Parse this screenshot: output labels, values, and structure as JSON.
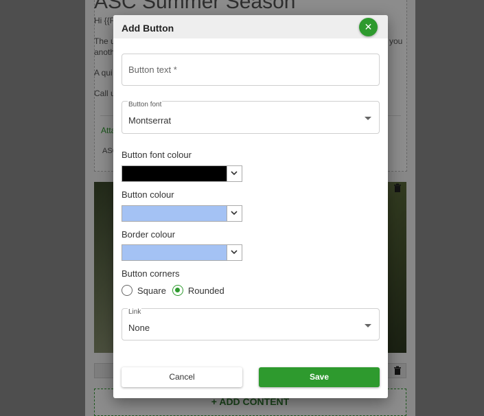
{
  "background": {
    "title": "ASC Summer Season",
    "greeting": "Hi {{F",
    "line1": "The u",
    "line1_right": "you",
    "line1b": "anoth",
    "line2": "A qui",
    "line3": "Call u",
    "attach_link": "Atta",
    "attach_item": "ASC",
    "add_content_label": "+ ADD CONTENT",
    "trash_icon": "trash-icon"
  },
  "dialog": {
    "title": "Add Button",
    "close_icon": "close-icon",
    "button_text": {
      "placeholder": "Button text *",
      "value": ""
    },
    "button_font": {
      "label": "Button font",
      "value": "Montserrat"
    },
    "font_colour": {
      "label": "Button font colour",
      "color": "#000000"
    },
    "button_colour": {
      "label": "Button colour",
      "color": "#a4c2f4"
    },
    "border_colour": {
      "label": "Border colour",
      "color": "#a4c2f4"
    },
    "corners": {
      "label": "Button corners",
      "options": [
        "Square",
        "Rounded"
      ],
      "selected": "Rounded"
    },
    "link": {
      "label": "Link",
      "value": "None"
    },
    "cancel_label": "Cancel",
    "save_label": "Save"
  },
  "colors": {
    "accent": "#2e9a2e"
  }
}
